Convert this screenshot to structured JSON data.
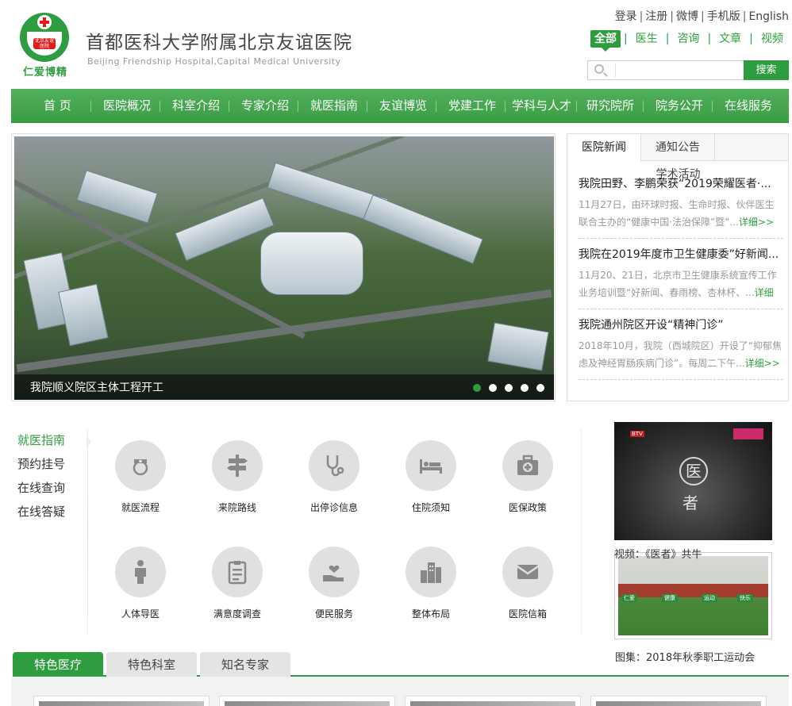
{
  "header": {
    "logo_motto": "仁爱博精",
    "logo_badge_text": "北京友谊医院",
    "title": "首都医科大学附属北京友谊医院",
    "subtitle": "Beijing Friendship Hospital,Capital Medical University",
    "top_links": [
      "登录",
      "注册",
      "微博",
      "手机版",
      "English"
    ]
  },
  "search": {
    "tabs": [
      "全部",
      "医生",
      "咨询",
      "文章",
      "视频"
    ],
    "active_tab": "全部",
    "placeholder": "",
    "button_label": "搜索"
  },
  "nav": {
    "items": [
      "首 页",
      "医院概况",
      "科室介绍",
      "专家介绍",
      "就医指南",
      "友谊博览",
      "党建工作",
      "学科与人才",
      "研究院所",
      "院务公开",
      "在线服务"
    ]
  },
  "slider": {
    "caption": "我院顺义院区主体工程开工",
    "dot_count": 5,
    "active_dot": 1
  },
  "news": {
    "tabs": [
      "医院新闻",
      "通知公告",
      "学术活动"
    ],
    "active_tab": "医院新闻",
    "entries": [
      {
        "title": "我院田野、李鹏荣获“2019荣耀医者·...",
        "desc": "11月27日，由环球时报、生命时报、伙伴医生联合主办的“健康中国·法治保障”暨“...",
        "more": "详细>>"
      },
      {
        "title": "我院在2019年度市卫生健康委”好新闻...",
        "desc": "11月20、21日，北京市卫生健康系统宣传工作业务培训暨“好新闻、春雨榜、杏林杯、...",
        "more": "详细>>"
      },
      {
        "title": "我院通州院区开设“精神门诊”",
        "desc": "2018年10月，我院（西城院区）开设了“抑郁焦虑及神经胃肠疾病门诊”。每周二下午...",
        "more": "详细>>"
      }
    ]
  },
  "guide": {
    "side_items": [
      "就医指南",
      "预约挂号",
      "在线查询",
      "在线答疑"
    ],
    "active_side": "就医指南",
    "services": [
      {
        "label": "就医流程",
        "icon": "nurse-icon"
      },
      {
        "label": "来院路线",
        "icon": "signpost-icon"
      },
      {
        "label": "出停诊信息",
        "icon": "stethoscope-icon"
      },
      {
        "label": "住院须知",
        "icon": "bed-icon"
      },
      {
        "label": "医保政策",
        "icon": "medical-kit-icon"
      },
      {
        "label": "人体导医",
        "icon": "human-body-icon"
      },
      {
        "label": "满意度调查",
        "icon": "clipboard-icon"
      },
      {
        "label": "便民服务",
        "icon": "heart-hand-icon"
      },
      {
        "label": "整体布局",
        "icon": "buildings-icon"
      },
      {
        "label": "医院信箱",
        "icon": "mail-icon"
      }
    ]
  },
  "media": {
    "video_caption": "视频：《医者》共牛",
    "video_logo": "BTV",
    "video_seal_top": "医",
    "video_seal_bottom": "者",
    "gallery_caption": "图集：2018年秋季职工运动会",
    "gallery_banners": [
      "仁爱",
      "健康",
      "运动",
      "快乐"
    ]
  },
  "features": {
    "tabs": [
      "特色医疗",
      "特色科室",
      "知名专家"
    ],
    "active_tab": "特色医疗"
  },
  "colors": {
    "brand_green": "#2e9d3f",
    "nav_green": "#3a9e44",
    "accent_red": "#e01c1c"
  }
}
